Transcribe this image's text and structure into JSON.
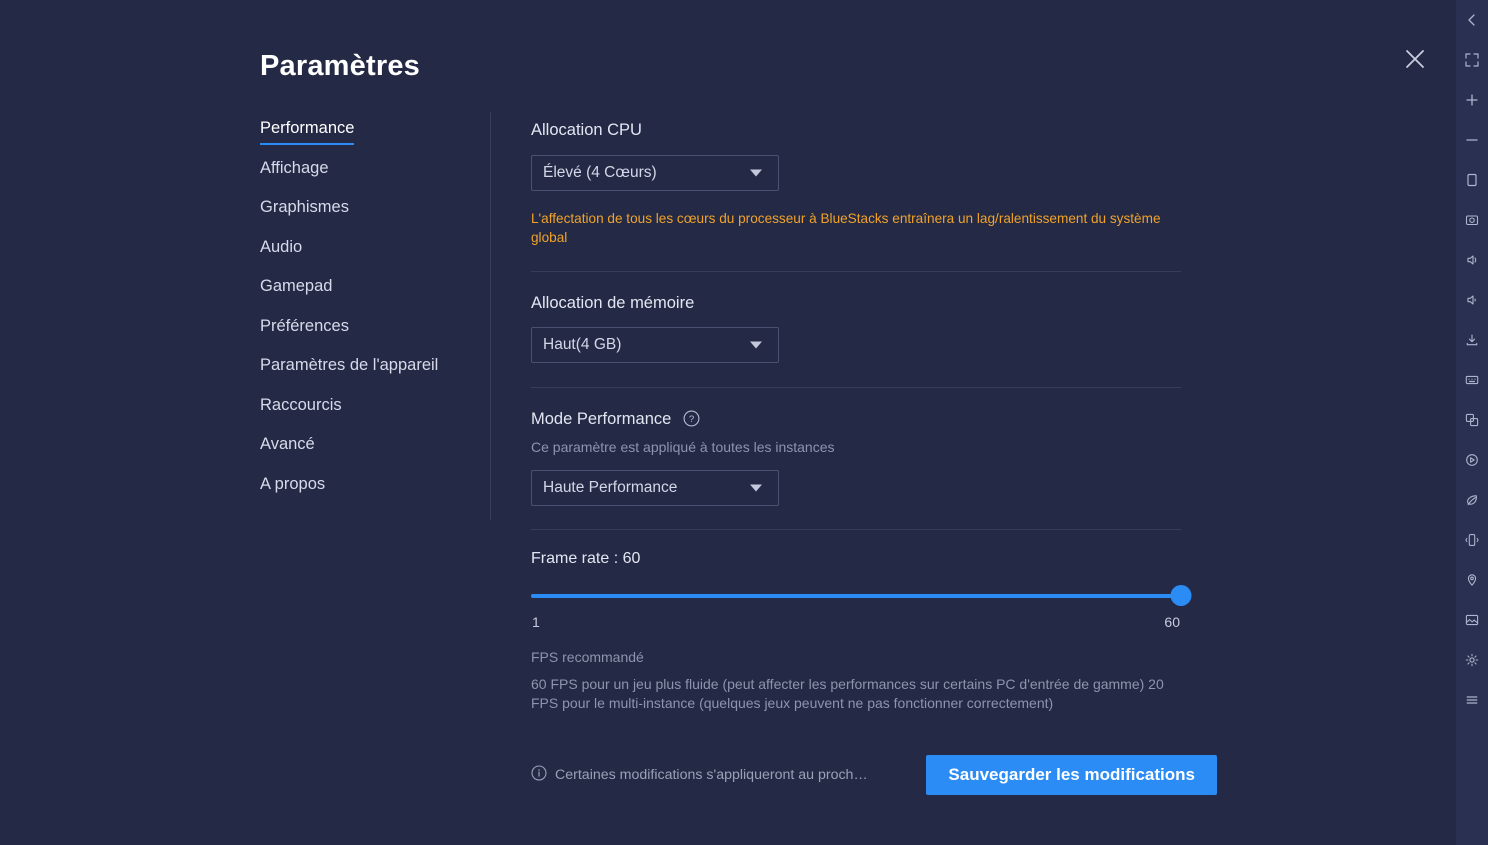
{
  "window": {
    "title": "Paramètres",
    "close_icon": "close-icon"
  },
  "sidebar": {
    "items": [
      {
        "label": "Performance",
        "active": true
      },
      {
        "label": "Affichage",
        "active": false
      },
      {
        "label": "Graphismes",
        "active": false
      },
      {
        "label": "Audio",
        "active": false
      },
      {
        "label": "Gamepad",
        "active": false
      },
      {
        "label": "Préférences",
        "active": false
      },
      {
        "label": "Paramètres de l'appareil",
        "active": false
      },
      {
        "label": "Raccourcis",
        "active": false
      },
      {
        "label": "Avancé",
        "active": false
      },
      {
        "label": "A propos",
        "active": false
      }
    ]
  },
  "main": {
    "cpu": {
      "label": "Allocation CPU",
      "value": "Élevé (4 Cœurs)",
      "warning": "L'affectation de tous les cœurs du processeur à BlueStacks entraînera un lag/ralentissement du système global"
    },
    "memory": {
      "label": "Allocation de mémoire",
      "value": "Haut(4 GB)"
    },
    "performance_mode": {
      "label": "Mode Performance",
      "help_icon": "help-circle-icon",
      "subtitle": "Ce paramètre est appliqué à toutes les instances",
      "value": "Haute Performance"
    },
    "frame_rate": {
      "label": "Frame rate : 60",
      "value": 60,
      "min": 1,
      "max": 60,
      "min_label": "1",
      "max_label": "60",
      "recommended_heading": "FPS recommandé",
      "recommended_body": "60 FPS pour un jeu plus fluide (peut affecter les performances sur certains PC d'entrée de gamme) 20 FPS pour le multi-instance (quelques jeux peuvent ne pas fonctionner correctement)"
    }
  },
  "footer": {
    "info_icon": "info-circle-icon",
    "note": "Certaines modifications s'appliqueront au proch…",
    "save_label": "Sauvegarder les modifications"
  },
  "toolbar": {
    "items": [
      {
        "icon": "chevron-left-icon"
      },
      {
        "icon": "fullscreen-icon"
      },
      {
        "icon": "zoom-in-icon"
      },
      {
        "icon": "zoom-out-icon"
      },
      {
        "icon": "rotate-icon"
      },
      {
        "icon": "screenshot-icon"
      },
      {
        "icon": "volume-up-icon"
      },
      {
        "icon": "volume-down-icon"
      },
      {
        "icon": "install-apk-icon"
      },
      {
        "icon": "keymapping-icon"
      },
      {
        "icon": "multi-instance-icon"
      },
      {
        "icon": "macro-icon"
      },
      {
        "icon": "eco-mode-icon"
      },
      {
        "icon": "shake-icon"
      },
      {
        "icon": "location-icon"
      },
      {
        "icon": "media-manager-icon"
      },
      {
        "icon": "settings-icon"
      },
      {
        "icon": "menu-icon"
      }
    ]
  },
  "colors": {
    "background": "#242a45",
    "accent": "#2b8cf5",
    "warning": "#f0a229",
    "toolbar_bg": "#2a3052"
  }
}
